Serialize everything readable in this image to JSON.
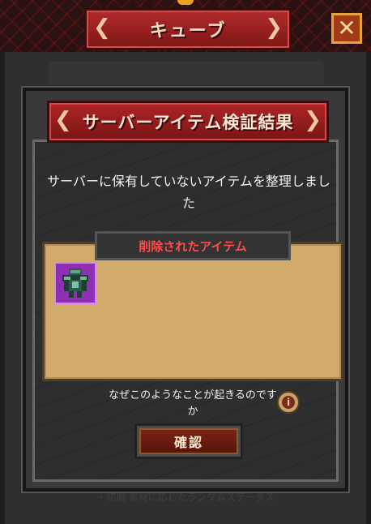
{
  "window": {
    "title": "キューブ",
    "close_icon": "close-icon",
    "footer_text": "・初期 素材に応じたランダムステータス"
  },
  "dialog": {
    "title": "サーバーアイテム検証結果",
    "message": "サーバーに保有していないアイテムを整理しました",
    "deleted_section": {
      "label": "削除されたアイテム",
      "items": [
        {
          "icon": "armor-icon",
          "rarity_color": "#8f2fb3"
        }
      ]
    },
    "why_text": "なぜこのようなことが起きるのですか",
    "info_icon": "info-icon",
    "confirm_label": "確認"
  },
  "colors": {
    "banner_red": "#b02626",
    "deleted_label": "#ff4d4d",
    "panel_parchment": "#d2aa6b"
  }
}
